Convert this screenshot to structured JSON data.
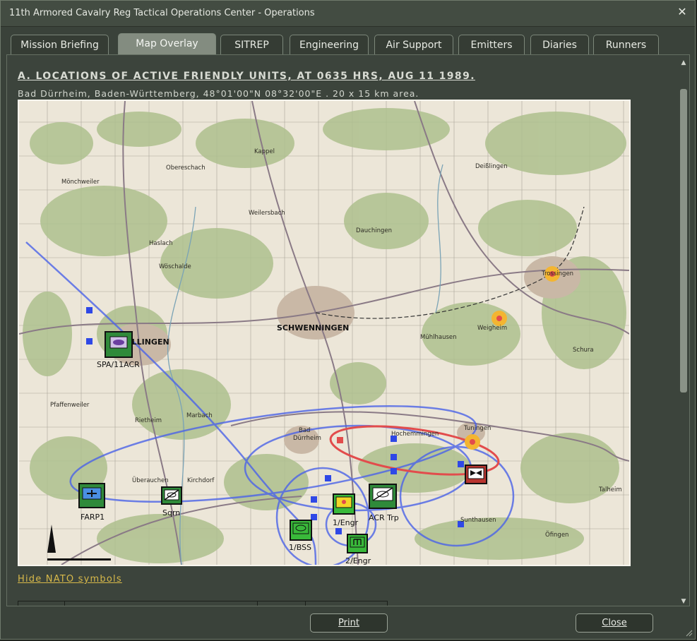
{
  "window": {
    "title": "11th Armored Cavalry Reg Tactical Operations Center - Operations",
    "close_glyph": "✕"
  },
  "tabs": [
    {
      "label": "Mission Briefing"
    },
    {
      "label": "Map Overlay"
    },
    {
      "label": "SITREP"
    },
    {
      "label": "Engineering"
    },
    {
      "label": "Air Support"
    },
    {
      "label": "Emitters"
    },
    {
      "label": "Diaries"
    },
    {
      "label": "Runners"
    }
  ],
  "active_tab": "Map Overlay",
  "content": {
    "heading": "A. LOCATIONS OF ACTIVE FRIENDLY UNITS, AT 0635 HRS, AUG 11 1989.",
    "subheading": "Bad Dürrheim, Baden-Württemberg, 48°01'00\"N 08°32'00\"E . 20 x 15 km area.",
    "hide_link": "Hide NATO symbols"
  },
  "map": {
    "towns": [
      {
        "name": "Kappel"
      },
      {
        "name": "Obereschach"
      },
      {
        "name": "Deißlingen"
      },
      {
        "name": "Mönchweiler"
      },
      {
        "name": "Weilersbach"
      },
      {
        "name": "Dauchingen"
      },
      {
        "name": "Haslach"
      },
      {
        "name": "Wöschalde"
      },
      {
        "name": "Trossingen"
      },
      {
        "name": "SCHWENNINGEN"
      },
      {
        "name": "Weigheim"
      },
      {
        "name": "Mühlhausen"
      },
      {
        "name": "Schura"
      },
      {
        "name": "VILLINGEN"
      },
      {
        "name": "Pfaffenweiler"
      },
      {
        "name": "Rietheim"
      },
      {
        "name": "Marbach"
      },
      {
        "name": "Bad"
      },
      {
        "name": "Dürrheim"
      },
      {
        "name": "Hochemmingen"
      },
      {
        "name": "Tuningen"
      },
      {
        "name": "Überauchen"
      },
      {
        "name": "Kirchdorf"
      },
      {
        "name": "Talheim"
      },
      {
        "name": "Sunthausen"
      },
      {
        "name": "Öfingen"
      }
    ],
    "units": [
      {
        "label": "SPA/11ACR",
        "symbol": "SPA/11ACR",
        "kind": "artillery",
        "color": "#2f8a3a"
      },
      {
        "label": "FARP1",
        "symbol": "FARP1",
        "kind": "aviation",
        "color": "#2f8a3a"
      },
      {
        "label": "Sqrn",
        "symbol": "",
        "kind": "armored-cav",
        "color": "#2f8a3a"
      },
      {
        "label": "1/Engr",
        "symbol": "1/Engr",
        "kind": "engineer",
        "color": "#39b93a"
      },
      {
        "label": "ACR Trp",
        "symbol": "ACR Trp",
        "kind": "armored-cav",
        "color": "#2f8a3a"
      },
      {
        "label": "1/BSS",
        "symbol": "1/BSS",
        "kind": "support",
        "color": "#39b93a"
      },
      {
        "label": "2/Engr",
        "symbol": "2/Engr",
        "kind": "engineer",
        "color": "#39b93a"
      }
    ],
    "enemy_unit": {
      "kind": "enemy-armor",
      "color": "#b8342f"
    },
    "hazard_markers": [
      "Trossingen",
      "Weigheim",
      "Tuningen"
    ]
  },
  "buttons": {
    "print": "Print",
    "close": "Close"
  },
  "icons": {
    "scroll_up": "▲",
    "scroll_down": "▼"
  }
}
